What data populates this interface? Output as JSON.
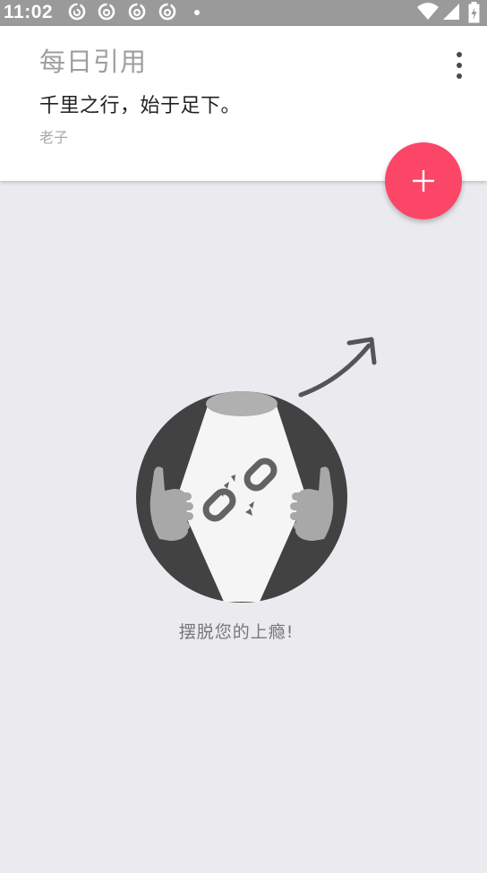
{
  "status_bar": {
    "time": "11:02",
    "notification_icons": [
      "netease-music-icon",
      "netease-music-icon",
      "netease-music-icon",
      "netease-music-icon"
    ],
    "more_notifications_icon": "dot-icon",
    "wifi_icon": "wifi-icon",
    "signal_icon": "signal-icon",
    "battery_icon": "battery-charging-icon"
  },
  "header": {
    "title": "每日引用",
    "menu_icon": "more-vert-icon"
  },
  "quote": {
    "text": "千里之行，始于足下。",
    "author": "老子"
  },
  "fab": {
    "icon": "plus-icon",
    "color": "#fb4667"
  },
  "illustration": {
    "name": "broken-chain-illustration"
  },
  "empty_state": {
    "message": "摆脱您的上瘾!"
  },
  "colors": {
    "background": "#ebebef",
    "status_bar": "#9a9a9a",
    "accent": "#fb4667",
    "header_title": "#9e9e9e"
  }
}
